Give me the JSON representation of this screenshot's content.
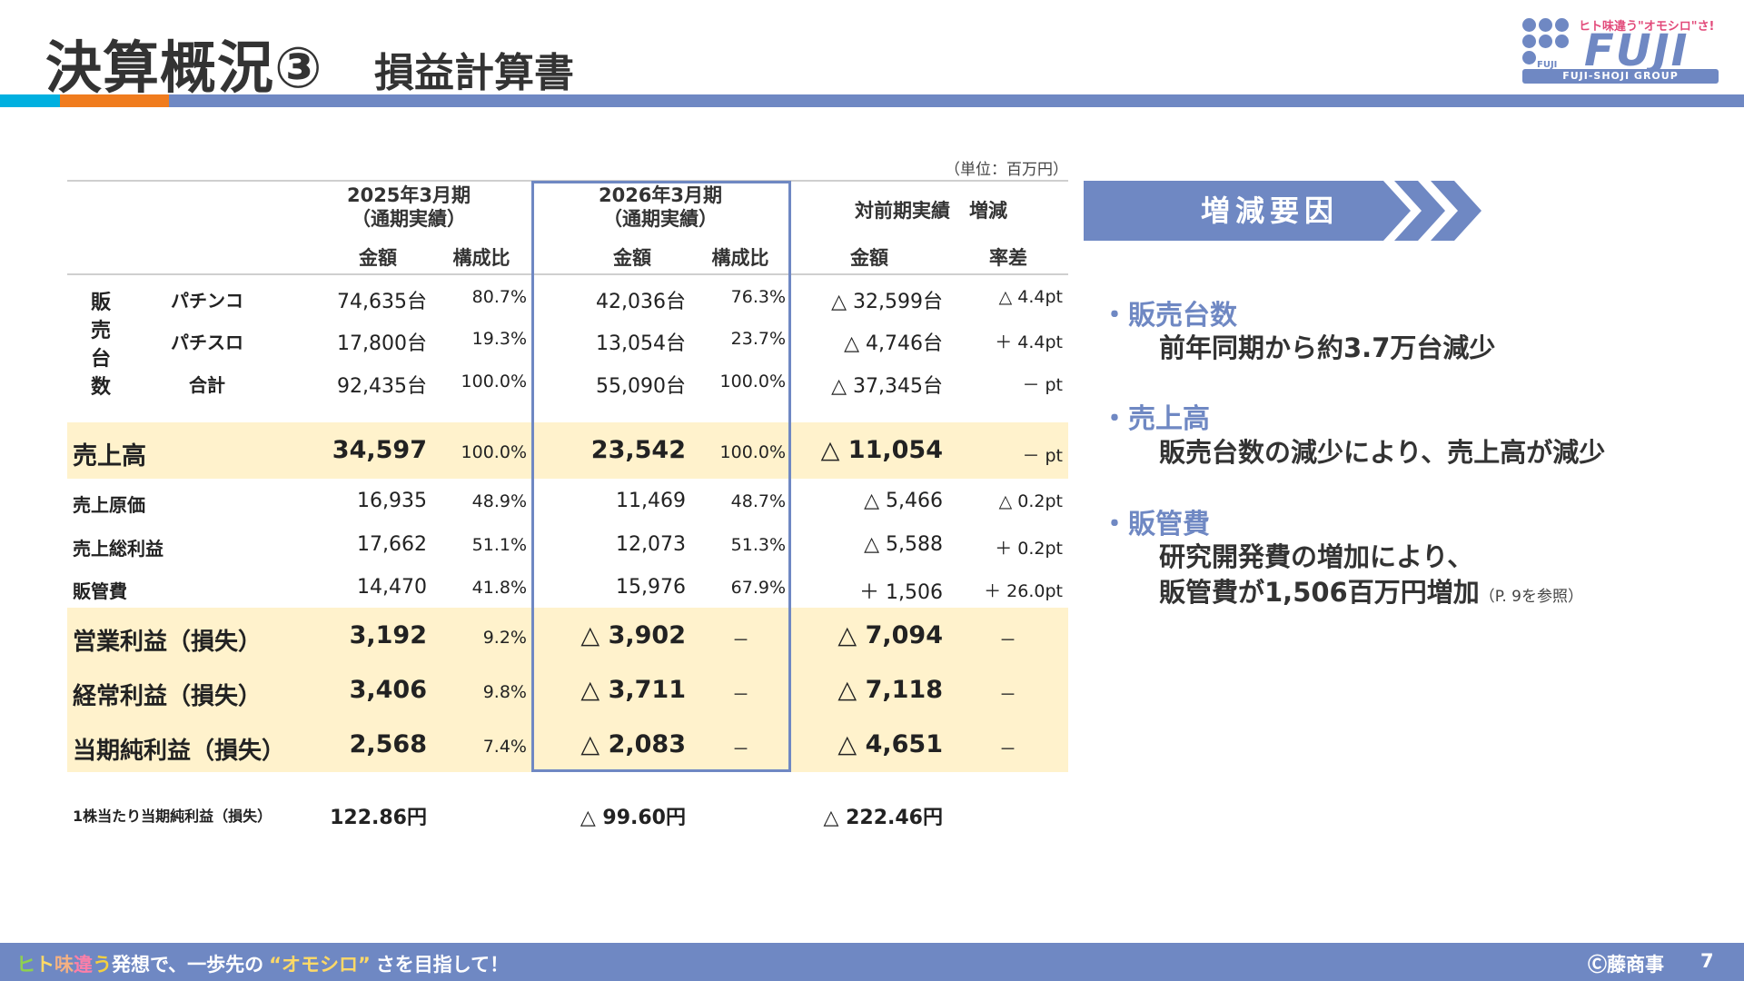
{
  "header": {
    "title": "決算概況③",
    "subtitle": "損益計算書"
  },
  "logo": {
    "tagline": "ヒト味違う\"オモシロ\"さ!",
    "wordmark": "FUJI",
    "small_text": "FUJI",
    "group": "FUJI-SHOJI GROUP",
    "color": "#6f88c3"
  },
  "table": {
    "unit": "（単位：百万円）",
    "periods": {
      "fy2025": "2025年3月期\n（通期実績）",
      "fy2026": "2026年3月期\n（通期実績）",
      "diff": "対前期実績　増減"
    },
    "subheaders": {
      "amount": "金額",
      "ratio": "構成比",
      "rate_diff": "率差"
    },
    "units_label": "販売台数",
    "units_rows": [
      {
        "label": "パチンコ",
        "fy2025_amount": "74,635台",
        "fy2025_ratio": "80.7%",
        "fy2026_amount": "42,036台",
        "fy2026_ratio": "76.3%",
        "diff_amount": "△ 32,599台",
        "diff_rate": "△ 4.4pt"
      },
      {
        "label": "パチスロ",
        "fy2025_amount": "17,800台",
        "fy2025_ratio": "19.3%",
        "fy2026_amount": "13,054台",
        "fy2026_ratio": "23.7%",
        "diff_amount": "△ 4,746台",
        "diff_rate": "＋ 4.4pt"
      },
      {
        "label": "合計",
        "fy2025_amount": "92,435台",
        "fy2025_ratio": "100.0%",
        "fy2026_amount": "55,090台",
        "fy2026_ratio": "100.0%",
        "diff_amount": "△ 37,345台",
        "diff_rate": "－ pt"
      }
    ],
    "sales": {
      "label": "売上高",
      "fy2025_amount": "34,597",
      "fy2025_ratio": "100.0%",
      "fy2026_amount": "23,542",
      "fy2026_ratio": "100.0%",
      "diff_amount": "△ 11,054",
      "diff_rate": "－ pt"
    },
    "minor_rows": [
      {
        "label": "売上原価",
        "fy2025_amount": "16,935",
        "fy2025_ratio": "48.9%",
        "fy2026_amount": "11,469",
        "fy2026_ratio": "48.7%",
        "diff_amount": "△ 5,466",
        "diff_rate": "△ 0.2pt"
      },
      {
        "label": "売上総利益",
        "fy2025_amount": "17,662",
        "fy2025_ratio": "51.1%",
        "fy2026_amount": "12,073",
        "fy2026_ratio": "51.3%",
        "diff_amount": "△ 5,588",
        "diff_rate": "＋ 0.2pt"
      },
      {
        "label": "販管費",
        "fy2025_amount": "14,470",
        "fy2025_ratio": "41.8%",
        "fy2026_amount": "15,976",
        "fy2026_ratio": "67.9%",
        "diff_amount": "＋ 1,506",
        "diff_rate": "＋ 26.0pt"
      }
    ],
    "profit_rows": [
      {
        "label": "営業利益（損失）",
        "fy2025_amount": "3,192",
        "fy2025_ratio": "9.2%",
        "fy2026_amount": "△ 3,902",
        "fy2026_ratio": "－",
        "diff_amount": "△ 7,094",
        "diff_rate": "－"
      },
      {
        "label": "経常利益（損失）",
        "fy2025_amount": "3,406",
        "fy2025_ratio": "9.8%",
        "fy2026_amount": "△ 3,711",
        "fy2026_ratio": "－",
        "diff_amount": "△ 7,118",
        "diff_rate": "－"
      },
      {
        "label": "当期純利益（損失）",
        "fy2025_amount": "2,568",
        "fy2025_ratio": "7.4%",
        "fy2026_amount": "△ 2,083",
        "fy2026_ratio": "－",
        "diff_amount": "△ 4,651",
        "diff_rate": "－"
      }
    ],
    "eps": {
      "label": "1株当たり当期純利益（損失）",
      "fy2025": "122.86円",
      "fy2026": "△ 99.60円",
      "diff": "△ 222.46円"
    },
    "highlight_color": "#fff2cc",
    "box_color": "#6f88c3"
  },
  "factors": {
    "banner": "増減要因",
    "items": [
      {
        "title": "・販売台数",
        "lines": [
          "前年同期から約3.7万台減少"
        ]
      },
      {
        "title": "・売上高",
        "lines": [
          "販売台数の減少により、売上高が減少"
        ]
      },
      {
        "title": "・販管費",
        "lines": [
          "研究開発費の増加により、",
          "販管費が1,506百万円増加"
        ],
        "note": "（P. 9を参照）"
      }
    ]
  },
  "footer": {
    "slogan_colored": [
      {
        "text": "ヒ",
        "color": "#8fd14f"
      },
      {
        "text": "ト",
        "color": "#ffd966"
      },
      {
        "text": "味",
        "color": "#f4b183"
      },
      {
        "text": "違",
        "color": "#ff7fa8"
      },
      {
        "text": "う",
        "color": "#f4d03f"
      }
    ],
    "slogan_part1": "発想で、一歩先の",
    "slogan_quote": "“オモシロ”",
    "slogan_part2": "さを目指して！",
    "copyright": "Ⓒ藤商事",
    "page_number": "7"
  }
}
